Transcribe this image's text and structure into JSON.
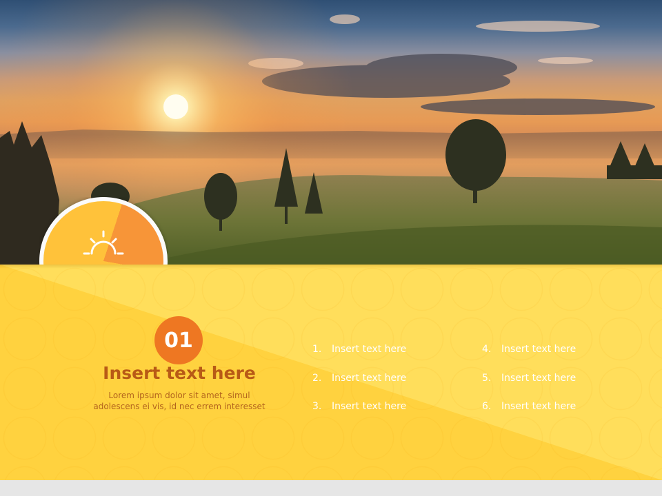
{
  "badge": {
    "icon": "sun-horizon-icon"
  },
  "section": {
    "number": "01",
    "title": "Insert text here",
    "description_line1": "Lorem ipsum dolor sit amet, simul",
    "description_line2": "adolescens ei vis, id nec errem interesset"
  },
  "list": [
    {
      "num": "1.",
      "text": "Insert text here"
    },
    {
      "num": "2.",
      "text": "Insert text here"
    },
    {
      "num": "3.",
      "text": "Insert text here"
    },
    {
      "num": "4.",
      "text": "Insert text here"
    },
    {
      "num": "5.",
      "text": "Insert text here"
    },
    {
      "num": "6.",
      "text": "Insert text here"
    }
  ],
  "colors": {
    "band": "#ffd23f",
    "accent_orange": "#ee7722",
    "title_brown": "#b85a16"
  }
}
